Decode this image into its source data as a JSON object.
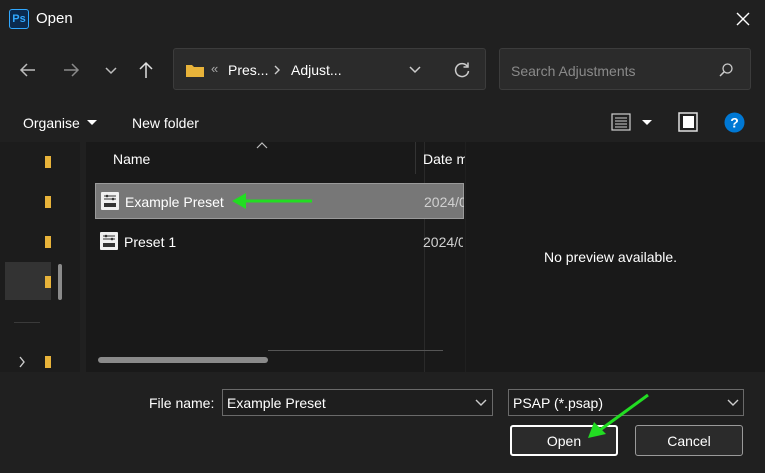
{
  "window": {
    "app_icon_text": "Ps",
    "title": "Open"
  },
  "address_bar": {
    "overflow": "«",
    "crumbs": [
      "Pres...",
      "Adjust..."
    ]
  },
  "search": {
    "placeholder": "Search Adjustments"
  },
  "toolbar": {
    "organise": "Organise",
    "new_folder": "New folder"
  },
  "columns": {
    "name": "Name",
    "date": "Date m"
  },
  "files": [
    {
      "name": "Example Preset",
      "date": "2024/0",
      "selected": true
    },
    {
      "name": "Preset 1",
      "date": "2024/0",
      "selected": false
    }
  ],
  "preview": {
    "message": "No preview available."
  },
  "bottom": {
    "file_name_label": "File name:",
    "file_name_value": "Example Preset",
    "file_type": "PSAP (*.psap)",
    "open_label": "Open",
    "cancel_label": "Cancel"
  },
  "colors": {
    "accent": "#0078d4",
    "annotation_arrow": "#22dd22",
    "folder": "#e8b33a"
  }
}
